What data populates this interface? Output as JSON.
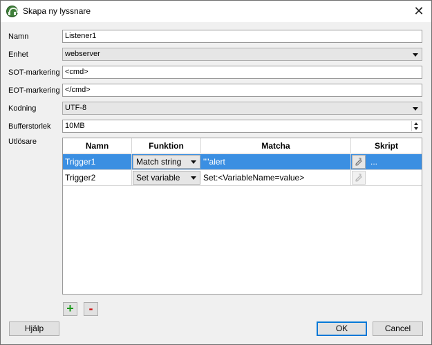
{
  "window": {
    "title": "Skapa ny lyssnare",
    "close_glyph": "✕"
  },
  "form": {
    "name": {
      "label": "Namn",
      "value": "Listener1"
    },
    "unit": {
      "label": "Enhet",
      "value": "webserver"
    },
    "sot": {
      "label": "SOT-markering",
      "value": "<cmd>"
    },
    "eot": {
      "label": "EOT-markering",
      "value": "</cmd>"
    },
    "encoding": {
      "label": "Kodning",
      "value": "UTF-8"
    },
    "buffer": {
      "label": "Bufferstorlek",
      "value": "10MB"
    },
    "triggers_label": "Utlösare"
  },
  "table": {
    "headers": {
      "name": "Namn",
      "function": "Funktion",
      "match": "Matcha",
      "script": "Skript"
    },
    "rows": [
      {
        "name": "Trigger1",
        "function": "Match string",
        "match": "\"\"alert",
        "script": "...",
        "selected": true
      },
      {
        "name": "Trigger2",
        "function": "Set variable",
        "match": "Set:<VariableName=value>",
        "script": "",
        "selected": false
      }
    ]
  },
  "buttons": {
    "add": "+",
    "remove": "-",
    "help": "Hjälp",
    "ok": "OK",
    "cancel": "Cancel"
  },
  "colors": {
    "selection": "#3b8fe2",
    "add": "#1a9a1a",
    "remove": "#cc1111",
    "default_border": "#0078d7"
  },
  "icons": {
    "app": "headset-icon",
    "script_button": "script-edit-icon"
  }
}
